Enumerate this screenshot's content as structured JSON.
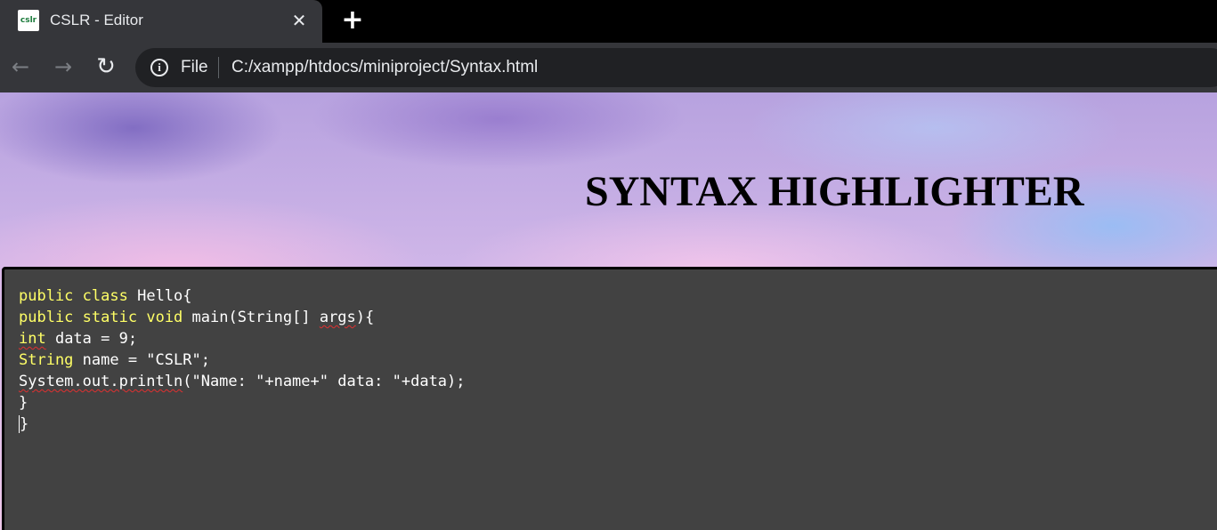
{
  "browser": {
    "tab": {
      "favicon_text": "cslr",
      "title": "CSLR - Editor",
      "close_glyph": "✕"
    },
    "new_tab_glyph": "+",
    "nav": {
      "back_icon": "←",
      "forward_icon": "→",
      "reload_icon": "↻"
    },
    "omnibox": {
      "info_icon": "i",
      "scheme_label": "File",
      "url": "C:/xampp/htdocs/miniproject/Syntax.html"
    }
  },
  "page": {
    "heading": "SYNTAX HIGHLIGHTER",
    "editor": {
      "lines": [
        [
          "public",
          " ",
          "class",
          " Hello{"
        ],
        [
          "public",
          " ",
          "static",
          " ",
          "void",
          " main(String[] ",
          "args",
          "){"
        ],
        [
          "int",
          " data = 9;"
        ],
        [
          "String",
          " name = \"CSLR\";"
        ],
        [
          "System.out.println",
          "(\"Name: \"+name+\" data: \"+data);"
        ],
        [
          "}"
        ],
        [
          "",
          "}"
        ]
      ]
    }
  },
  "colors": {
    "keyword": "#ffff66",
    "editor_bg": "#424242",
    "spellcheck_underline": "#e03030"
  }
}
